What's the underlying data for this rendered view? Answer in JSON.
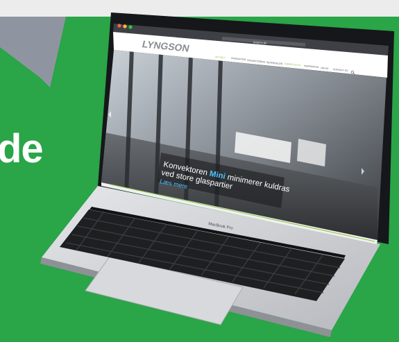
{
  "headline_fragment": "de",
  "website": {
    "url": "lyngson.dk",
    "logo": "LYNGSON",
    "nav_items": [
      "AKTUELT",
      "PRODUKTER",
      "PROJEKTERING",
      "REFERENCER",
      "BÆREDYGTIG",
      "INSPIRATION",
      "OM OS",
      "KONTAKT OS"
    ],
    "active_nav_item": "BÆREDYGTIG",
    "hero_line1_before": "Konvektoren ",
    "hero_line1_highlight": "Mini",
    "hero_line1_after": " minimerer kuldras",
    "hero_line2": "ved store glaspartier",
    "hero_link": "Læs mere"
  },
  "laptop_label": "MacBook Pro",
  "colors": {
    "background_green": "#2aa548",
    "arrow_gray": "#8f95a0",
    "accent_green": "#8cc63f",
    "highlight_cyan": "#4fc3ff"
  },
  "icons": [
    "arrow-shape",
    "search-icon",
    "prev-arrow-icon",
    "next-arrow-icon"
  ]
}
